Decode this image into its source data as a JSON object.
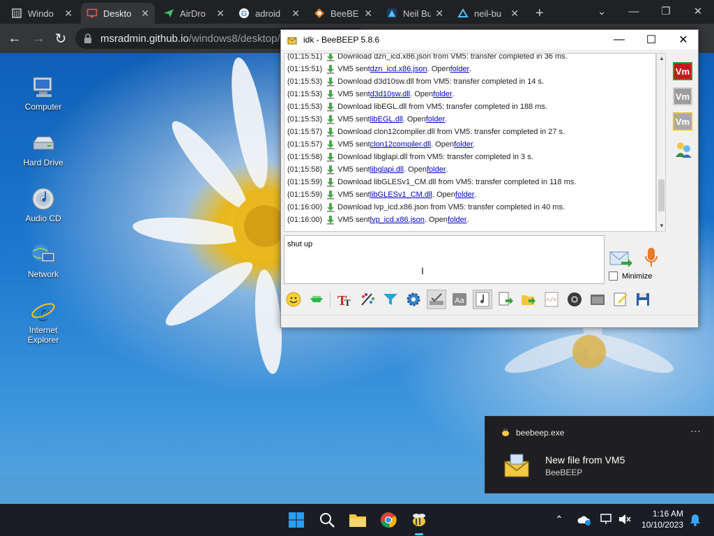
{
  "browser": {
    "tabs": [
      {
        "label": "Windo",
        "icon": "page-icon"
      },
      {
        "label": "Deskto",
        "icon": "monitor-icon"
      },
      {
        "label": "AirDro",
        "icon": "airdroid-icon"
      },
      {
        "label": "adroid",
        "icon": "google-icon"
      },
      {
        "label": "BeeBE",
        "icon": "beebeep-icon"
      },
      {
        "label": "Neil Bu",
        "icon": "nb-icon"
      },
      {
        "label": "neil-bu",
        "icon": "nb-icon"
      }
    ],
    "new_tab": "+",
    "url_host": "msradmin.github.io",
    "url_path": "/windows8/desktop/de"
  },
  "desktop": {
    "icons": [
      {
        "label": "Computer",
        "icon": "computer-icon"
      },
      {
        "label": "Hard Drive",
        "icon": "hard-drive-icon"
      },
      {
        "label": "Audio CD",
        "icon": "audio-cd-icon"
      },
      {
        "label": "Network",
        "icon": "network-icon"
      },
      {
        "label": "Internet Explorer",
        "icon": "internet-explorer-icon"
      }
    ]
  },
  "app": {
    "title": "idk - BeeBEEP 5.8.6",
    "log": [
      {
        "time": "(01:15:51)",
        "pre": "Download dzn_icd.x86.json from VM5: transfer completed in 36 ms.",
        "link": "",
        "post": "",
        "folder": ""
      },
      {
        "time": "(01:15:51)",
        "pre": "VM5 sent ",
        "link": "dzn_icd.x86.json",
        "post": ". Open ",
        "folder": "folder"
      },
      {
        "time": "(01:15:53)",
        "pre": "Download d3d10sw.dll from VM5: transfer completed in 14 s.",
        "link": "",
        "post": "",
        "folder": ""
      },
      {
        "time": "(01:15:53)",
        "pre": "VM5 sent ",
        "link": "d3d10sw.dll",
        "post": ". Open ",
        "folder": "folder"
      },
      {
        "time": "(01:15:53)",
        "pre": "Download libEGL.dll from VM5: transfer completed in 188 ms.",
        "link": "",
        "post": "",
        "folder": ""
      },
      {
        "time": "(01:15:53)",
        "pre": "VM5 sent ",
        "link": "libEGL.dll",
        "post": ". Open ",
        "folder": "folder"
      },
      {
        "time": "(01:15:57)",
        "pre": "Download clon12compiler.dll from VM5: transfer completed in 27 s.",
        "link": "",
        "post": "",
        "folder": ""
      },
      {
        "time": "(01:15:57)",
        "pre": "VM5 sent ",
        "link": "clon12compiler.dll",
        "post": ". Open ",
        "folder": "folder"
      },
      {
        "time": "(01:15:58)",
        "pre": "Download libglapi.dll from VM5: transfer completed in 3 s.",
        "link": "",
        "post": "",
        "folder": ""
      },
      {
        "time": "(01:15:58)",
        "pre": "VM5 sent ",
        "link": "libglapi.dll",
        "post": ". Open ",
        "folder": "folder"
      },
      {
        "time": "(01:15:59)",
        "pre": "Download libGLESv1_CM.dll from VM5: transfer completed in 118 ms.",
        "link": "",
        "post": "",
        "folder": ""
      },
      {
        "time": "(01:15:59)",
        "pre": "VM5 sent ",
        "link": "libGLESv1_CM.dll",
        "post": ". Open ",
        "folder": "folder"
      },
      {
        "time": "(01:16:00)",
        "pre": "Download lvp_icd.x86.json from VM5: transfer completed in 40 ms.",
        "link": "",
        "post": "",
        "folder": ""
      },
      {
        "time": "(01:16:00)",
        "pre": "VM5 sent ",
        "link": "lvp_icd.x86.json",
        "post": ". Open ",
        "folder": "folder"
      }
    ],
    "sidebar": [
      {
        "label": "Vm",
        "bg": "#c8161d",
        "border": "#2e9b2e"
      },
      {
        "label": "Vm",
        "bg": "#9c9c9c",
        "border": "#d0d0d0"
      },
      {
        "label": "Vm",
        "bg": "#a8a8a8",
        "border": "#e2c81a"
      }
    ],
    "compose_text": "shut up",
    "minimize_label": "Minimize",
    "format_buttons": [
      "emoticon-icon",
      "highlighter-icon",
      "text-format-icon",
      "color-palette-icon",
      "filter-icon",
      "settings-icon",
      "spell-check-icon",
      "font-icon",
      "music-note-icon",
      "send-file-icon",
      "send-folder-icon",
      "code-icon",
      "screenshot-icon",
      "clear-icon",
      "save-icon",
      "floppy-icon"
    ]
  },
  "toast": {
    "app": "beebeep.exe",
    "menu": "···",
    "title": "New file from VM5",
    "subtitle": "BeeBEEP"
  },
  "taskbar": {
    "time": "1:16 AM",
    "date": "10/10/2023",
    "icons": [
      "windows-start-icon",
      "search-icon",
      "file-explorer-icon",
      "chrome-icon",
      "beebeep-icon"
    ]
  },
  "colors": {
    "accent": "#0078d4",
    "link": "#0000cc",
    "toast_bg": "#1f1f22"
  }
}
